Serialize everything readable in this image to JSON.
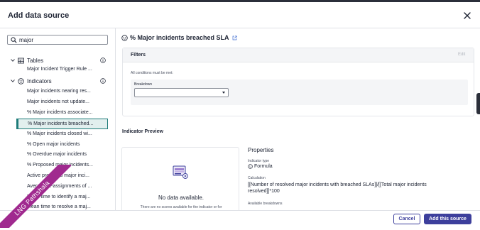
{
  "dialog": {
    "title": "Add data source",
    "cancel_label": "Cancel",
    "add_label": "Add this source"
  },
  "search": {
    "value": "major",
    "placeholder": ""
  },
  "tree": {
    "tables_label": "Tables",
    "table_items": [
      "Major Incident Trigger Rule ..."
    ],
    "indicators_label": "Indicators",
    "indicator_items": [
      "Major incidents nearing res...",
      "Major incidents not update...",
      "% Major incidents associate...",
      "% Major incidents breached...",
      "% Major incidents closed wi...",
      "% Open major incidents",
      "% Overdue major incidents",
      "% Proposed major incidents...",
      "Active proposed major inci...",
      "Average re-assignments of ...",
      "Mean time to identify a maj...",
      "Mean time to resolve a maj..."
    ]
  },
  "indicator": {
    "title": "% Major incidents breached SLA"
  },
  "filters": {
    "label": "Filters",
    "edit_label": "Edit",
    "conditions_text": "All conditions must be met:",
    "breakdown_label": "Breakdown",
    "breakdown_value": ""
  },
  "preview": {
    "label": "Indicator Preview",
    "no_data": "No data available.",
    "no_data_sub": "There are no scores available for the indicator or for"
  },
  "properties": {
    "title": "Properties",
    "type_label": "Indicator type",
    "type_value": "Formula",
    "calc_label": "Calculation",
    "calc_value": "[[Number of resolved major incidents with breached SLAs]]/[[Total major incidents resolved]]*100",
    "breakdowns_label": "Available breakdowns"
  },
  "ribbon": {
    "text": "LNG Pathshala"
  },
  "colors": {
    "primary": "#3d3f9c",
    "selected_bg": "#e2efee",
    "selected_border": "#1d7b79",
    "ribbon": "#a02a8f"
  }
}
